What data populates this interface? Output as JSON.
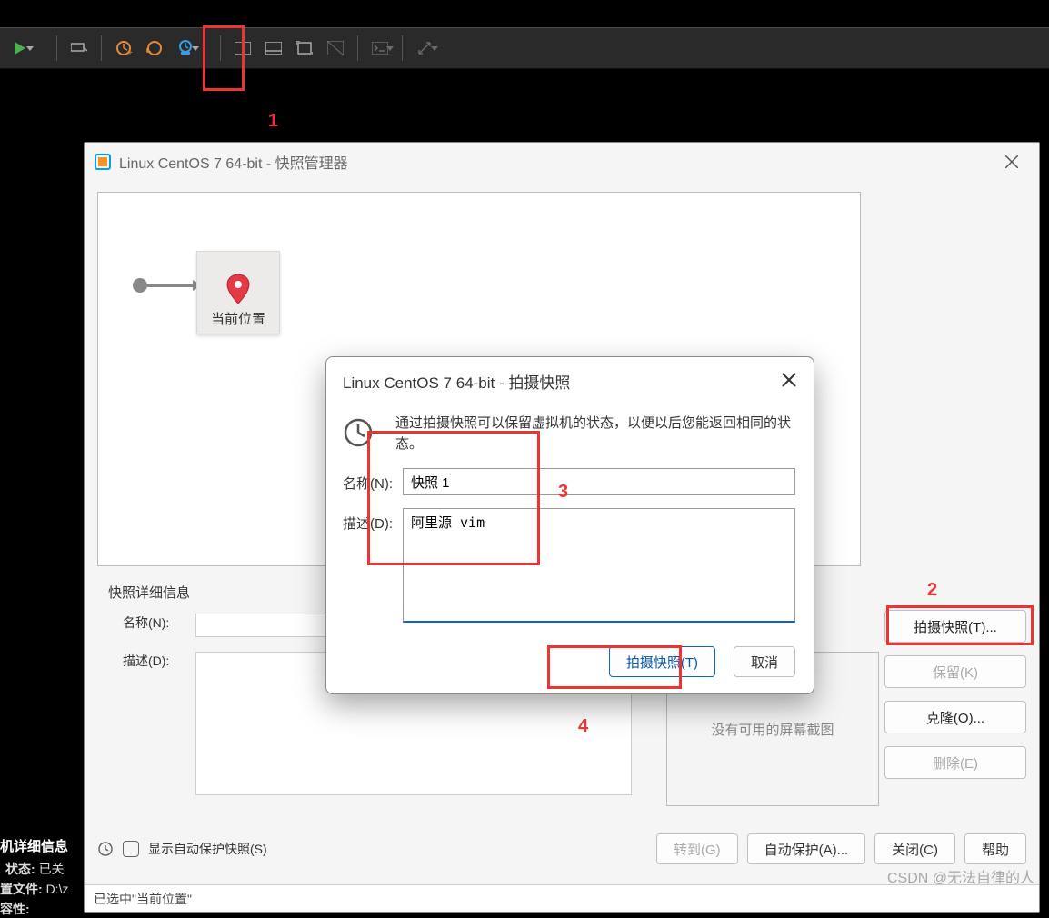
{
  "manager": {
    "title": "Linux CentOS 7 64-bit - 快照管理器",
    "current_location_label": "当前位置",
    "details_header": "快照详细信息",
    "name_label": "名称(N):",
    "desc_label": "描述(D):",
    "no_screenshot": "没有可用的屏幕截图",
    "side_buttons": {
      "take": "拍摄快照(T)...",
      "keep": "保留(K)",
      "clone": "克隆(O)...",
      "delete": "删除(E)"
    },
    "footer": {
      "show_autoprotect": "显示自动保护快照(S)",
      "goto": "转到(G)",
      "autoprotect": "自动保护(A)...",
      "close": "关闭(C)",
      "help": "帮助"
    },
    "statusbar": "已选中\"当前位置\""
  },
  "modal": {
    "title": "Linux CentOS 7 64-bit - 拍摄快照",
    "description": "通过拍摄快照可以保留虚拟机的状态，以便以后您能返回相同的状态。",
    "name_label": "名称(N):",
    "desc_label": "描述(D):",
    "name_value": "快照 1",
    "desc_value": "阿里源 vim",
    "take": "拍摄快照(T)",
    "cancel": "取消"
  },
  "background": {
    "panel_title": "机详细信息",
    "state_label": "状态:",
    "state_value": "已关",
    "file_label": "置文件:",
    "file_value": "D:\\z",
    "compat_label": "容性:"
  },
  "annotations": {
    "a1": "1",
    "a2": "2",
    "a3": "3",
    "a4": "4"
  },
  "watermark": "CSDN @无法自律的人"
}
